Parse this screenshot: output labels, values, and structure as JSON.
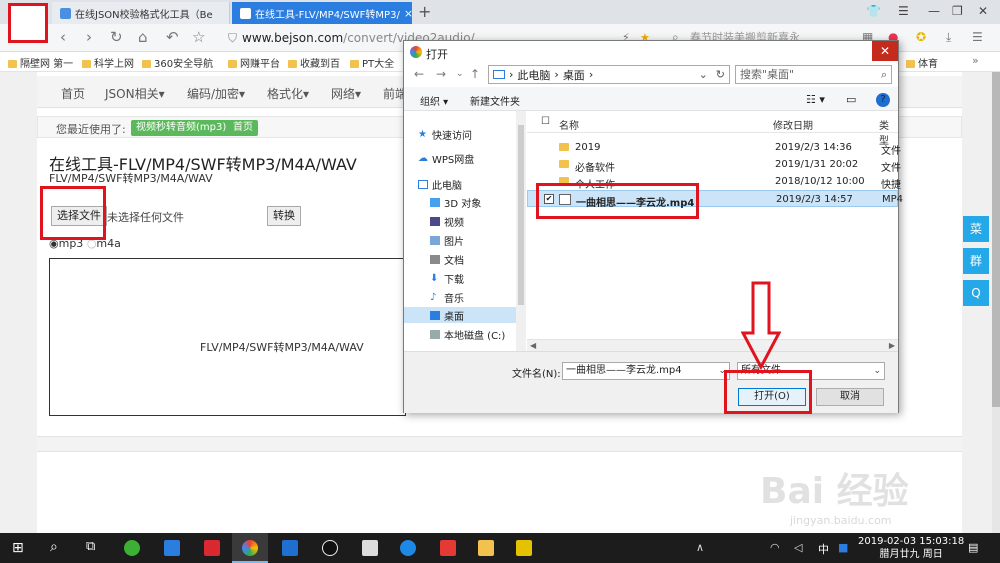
{
  "browser": {
    "tabs": [
      {
        "label": "在线JSON校验格式化工具（Be"
      },
      {
        "label": "在线工具-FLV/MP4/SWF转MP3/"
      }
    ],
    "new_tab": "+",
    "url_host": "www.bejson.com",
    "url_path": "/convert/video2audio/",
    "search_hint": "春节时装美搬剪新嘉永",
    "bookmarks": [
      "隔壁网 第一",
      "科学上网",
      "360安全导航",
      "网赚平台",
      "收藏到百",
      "PT大全",
      "体育"
    ]
  },
  "site": {
    "menu": [
      "首页",
      "JSON相关▾",
      "编码/加密▾",
      "格式化▾",
      "网络▾",
      "前端"
    ],
    "recent_label": "您最近使用了:",
    "recent_tags": [
      "视频秒转音频(mp3)",
      "首页"
    ],
    "title": "在线工具-FLV/MP4/SWF转MP3/M4A/WAV",
    "subtitle": "FLV/MP4/SWF转MP3/M4A/WAV",
    "choose_file": "选择文件",
    "no_file": "未选择任何文件",
    "convert": "转换",
    "radio_options": [
      "mp3",
      "m4a"
    ],
    "box_text": "FLV/MP4/SWF转MP3/M4A/WAV",
    "side_buttons": [
      "菜",
      "群",
      "Q"
    ]
  },
  "dialog": {
    "title": "打开",
    "path": [
      "此电脑",
      "桌面"
    ],
    "search_placeholder": "搜索\"桌面\"",
    "organize": "组织 ▾",
    "new_folder": "新建文件夹",
    "help": "?",
    "nav": [
      {
        "label": "快速访问"
      },
      {
        "label": "WPS网盘"
      },
      {
        "label": "此电脑"
      },
      {
        "label": "3D 对象"
      },
      {
        "label": "视频"
      },
      {
        "label": "图片"
      },
      {
        "label": "文档"
      },
      {
        "label": "下载"
      },
      {
        "label": "音乐"
      },
      {
        "label": "桌面"
      },
      {
        "label": "本地磁盘 (C:)"
      }
    ],
    "columns": [
      "名称",
      "修改日期",
      "类型"
    ],
    "files": [
      {
        "name": "2019",
        "date": "2019/2/3 14:36",
        "type": "文件"
      },
      {
        "name": "必备软件",
        "date": "2019/1/31 20:02",
        "type": "文件"
      },
      {
        "name": "个人工作",
        "date": "2018/10/12 10:00",
        "type": "快捷"
      },
      {
        "name": "一曲相思——李云龙.mp4",
        "date": "2019/2/3 14:57",
        "type": "MP4"
      }
    ],
    "filename_label": "文件名(N):",
    "filename_value": "一曲相思——李云龙.mp4",
    "filetype": "所有文件",
    "open_button": "打开(O)",
    "cancel_button": "取消"
  },
  "taskbar": {
    "time": "2019-02-03 15:03:18",
    "date": "腊月廿九 周日",
    "ime": "中"
  },
  "watermark": {
    "main": "Bai 经验",
    "sub": "jingyan.baidu.com"
  }
}
